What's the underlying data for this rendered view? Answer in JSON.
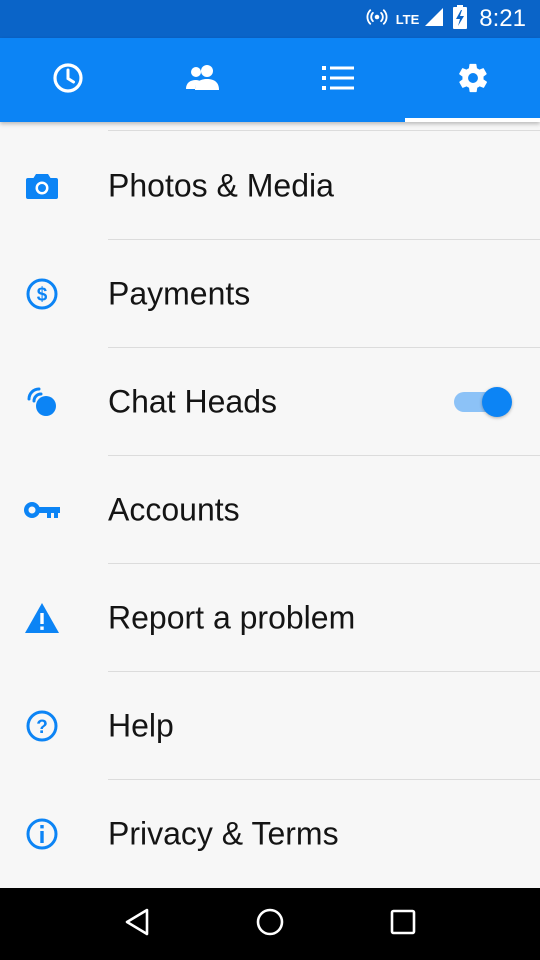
{
  "status_bar": {
    "network": "LTE",
    "time": "8:21",
    "icons": [
      "hotspot-icon",
      "signal-icon",
      "battery-charging-icon"
    ]
  },
  "tabs": [
    {
      "name": "recent",
      "icon": "clock-icon",
      "active": false
    },
    {
      "name": "people",
      "icon": "people-icon",
      "active": false
    },
    {
      "name": "groups",
      "icon": "list-icon",
      "active": false
    },
    {
      "name": "settings",
      "icon": "gear-icon",
      "active": true
    }
  ],
  "settings": {
    "items": [
      {
        "label": "Photos & Media",
        "icon": "camera-icon"
      },
      {
        "label": "Payments",
        "icon": "dollar-icon"
      },
      {
        "label": "Chat Heads",
        "icon": "chat-heads-icon",
        "toggle": true,
        "toggle_on": true
      },
      {
        "label": "Accounts",
        "icon": "key-icon"
      },
      {
        "label": "Report a problem",
        "icon": "warning-icon"
      },
      {
        "label": "Help",
        "icon": "help-icon"
      },
      {
        "label": "Privacy & Terms",
        "icon": "info-icon"
      }
    ]
  },
  "nav_bar": {
    "buttons": [
      "back-icon",
      "home-icon",
      "recents-icon"
    ]
  },
  "colors": {
    "status_bar": "#0a64c8",
    "tab_bar": "#0c84f5",
    "icon_blue": "#0c84f5",
    "background": "#f7f7f7",
    "text": "#141414"
  }
}
